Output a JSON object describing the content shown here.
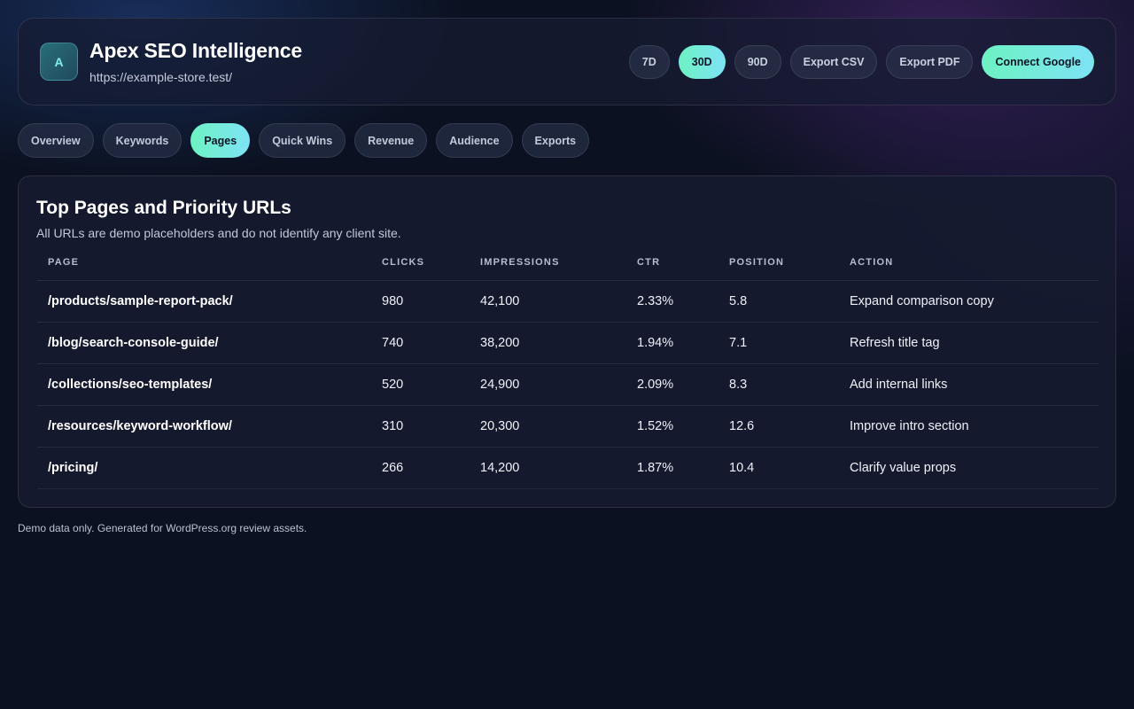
{
  "header": {
    "logo_letter": "A",
    "title": "Apex SEO Intelligence",
    "url": "https://example-store.test/",
    "actions": [
      {
        "label": "7D",
        "active": false
      },
      {
        "label": "30D",
        "active": true
      },
      {
        "label": "90D",
        "active": false
      },
      {
        "label": "Export CSV",
        "active": false
      },
      {
        "label": "Export PDF",
        "active": false
      },
      {
        "label": "Connect Google",
        "active": true
      }
    ]
  },
  "tabs": [
    {
      "label": "Overview",
      "active": false
    },
    {
      "label": "Keywords",
      "active": false
    },
    {
      "label": "Pages",
      "active": true
    },
    {
      "label": "Quick Wins",
      "active": false
    },
    {
      "label": "Revenue",
      "active": false
    },
    {
      "label": "Audience",
      "active": false
    },
    {
      "label": "Exports",
      "active": false
    }
  ],
  "card": {
    "title": "Top Pages and Priority URLs",
    "subtitle": "All URLs are demo placeholders and do not identify any client site.",
    "columns": [
      "Page",
      "Clicks",
      "Impressions",
      "CTR",
      "Position",
      "Action"
    ],
    "rows": [
      [
        "/products/sample-report-pack/",
        "980",
        "42,100",
        "2.33%",
        "5.8",
        "Expand comparison copy"
      ],
      [
        "/blog/search-console-guide/",
        "740",
        "38,200",
        "1.94%",
        "7.1",
        "Refresh title tag"
      ],
      [
        "/collections/seo-templates/",
        "520",
        "24,900",
        "2.09%",
        "8.3",
        "Add internal links"
      ],
      [
        "/resources/keyword-workflow/",
        "310",
        "20,300",
        "1.52%",
        "12.6",
        "Improve intro section"
      ],
      [
        "/pricing/",
        "266",
        "14,200",
        "1.87%",
        "10.4",
        "Clarify value props"
      ]
    ]
  },
  "footer": "Demo data only. Generated for WordPress.org review assets.",
  "colors": {
    "accent_start": "#6df2c2",
    "accent_end": "#7ee3f5",
    "background": "#0b1120"
  }
}
